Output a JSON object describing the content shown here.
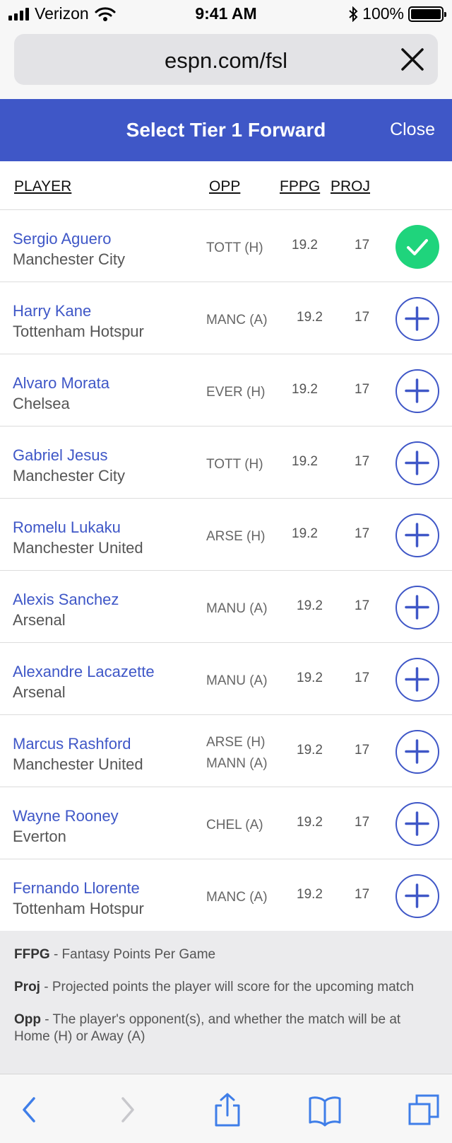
{
  "status_bar": {
    "carrier": "Verizon",
    "time": "9:41 AM",
    "battery": "100%"
  },
  "browser": {
    "url": "espn.com/fsl"
  },
  "header": {
    "title": "Select Tier 1 Forward",
    "close_label": "Close"
  },
  "columns": {
    "player": "PLAYER",
    "opp": "OPP",
    "fppg": "FPPG",
    "proj": "PROJ"
  },
  "players": [
    {
      "name": "Sergio Aguero",
      "team": "Manchester City",
      "opp": [
        "TOTT (H)"
      ],
      "fppg": "19.2",
      "proj": "17",
      "selected": true
    },
    {
      "name": "Harry Kane",
      "team": "Tottenham Hotspur",
      "opp": [
        "MANC (A)"
      ],
      "fppg": "19.2",
      "proj": "17",
      "selected": false
    },
    {
      "name": "Alvaro Morata",
      "team": "Chelsea",
      "opp": [
        "EVER (H)"
      ],
      "fppg": "19.2",
      "proj": "17",
      "selected": false
    },
    {
      "name": "Gabriel Jesus",
      "team": "Manchester City",
      "opp": [
        "TOTT (H)"
      ],
      "fppg": "19.2",
      "proj": "17",
      "selected": false
    },
    {
      "name": "Romelu Lukaku",
      "team": "Manchester United",
      "opp": [
        "ARSE (H)"
      ],
      "fppg": "19.2",
      "proj": "17",
      "selected": false
    },
    {
      "name": "Alexis Sanchez",
      "team": "Arsenal",
      "opp": [
        "MANU (A)"
      ],
      "fppg": "19.2",
      "proj": "17",
      "selected": false
    },
    {
      "name": "Alexandre Lacazette",
      "team": "Arsenal",
      "opp": [
        "MANU (A)"
      ],
      "fppg": "19.2",
      "proj": "17",
      "selected": false
    },
    {
      "name": "Marcus Rashford",
      "team": "Manchester United",
      "opp": [
        "ARSE (H)",
        "MANN (A)"
      ],
      "fppg": "19.2",
      "proj": "17",
      "selected": false
    },
    {
      "name": "Wayne Rooney",
      "team": "Everton",
      "opp": [
        "CHEL (A)"
      ],
      "fppg": "19.2",
      "proj": "17",
      "selected": false
    },
    {
      "name": "Fernando Llorente",
      "team": "Tottenham Hotspur",
      "opp": [
        "MANC (A)"
      ],
      "fppg": "19.2",
      "proj": "17",
      "selected": false
    }
  ],
  "legend": [
    {
      "term": "FFPG",
      "definition": " - Fantasy Points Per Game"
    },
    {
      "term": "Proj",
      "definition": " - Projected points the player will score for the upcoming match"
    },
    {
      "term": "Opp",
      "definition": " - The player's opponent(s), and whether the match will be at Home (H) or Away (A)"
    }
  ],
  "toolbar": {
    "icons": [
      "back-icon",
      "forward-icon",
      "share-icon",
      "bookmarks-icon",
      "tabs-icon"
    ]
  },
  "colors": {
    "brand": "#3f57c7",
    "selected": "#1fd47c"
  }
}
